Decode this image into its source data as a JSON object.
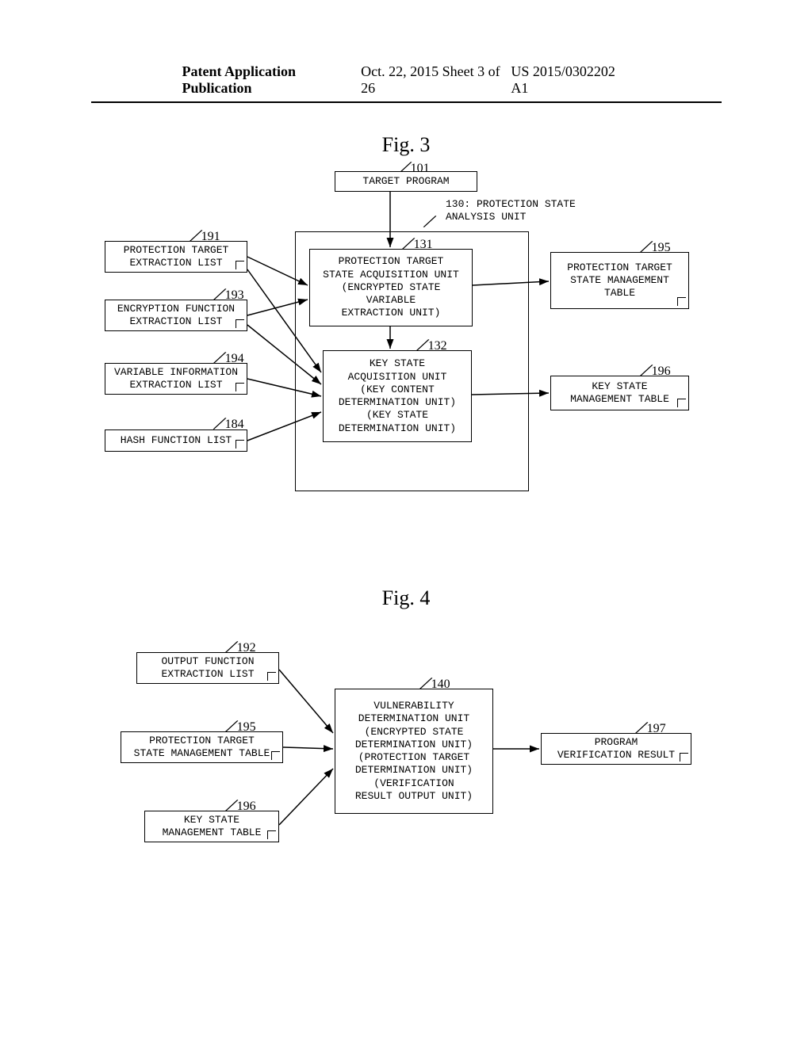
{
  "header": {
    "left": "Patent Application Publication",
    "center": "Oct. 22, 2015  Sheet 3 of 26",
    "right": "US 2015/0302202 A1"
  },
  "fig3": {
    "title": "Fig. 3",
    "unit_label": "130: PROTECTION STATE ANALYSIS UNIT",
    "refs": {
      "r101": "101",
      "r130": "130",
      "r131": "131",
      "r132": "132",
      "r191": "191",
      "r193": "193",
      "r194": "194",
      "r184": "184",
      "r195": "195",
      "r196": "196"
    },
    "boxes": {
      "target_program": "TARGET PROGRAM",
      "prot_target_ext_list": "PROTECTION TARGET\nEXTRACTION LIST",
      "enc_func_ext_list": "ENCRYPTION FUNCTION\nEXTRACTION LIST",
      "var_info_ext_list": "VARIABLE INFORMATION\nEXTRACTION LIST",
      "hash_func_list": "HASH FUNCTION LIST",
      "unit131": "PROTECTION TARGET\nSTATE ACQUISITION UNIT\n(ENCRYPTED STATE\nVARIABLE\nEXTRACTION UNIT)",
      "unit132": "KEY STATE\nACQUISITION UNIT\n(KEY CONTENT\nDETERMINATION UNIT)\n(KEY STATE\nDETERMINATION UNIT)",
      "table195": "PROTECTION TARGET\nSTATE MANAGEMENT\nTABLE",
      "table196": "KEY STATE\nMANAGEMENT TABLE"
    }
  },
  "fig4": {
    "title": "Fig. 4",
    "refs": {
      "r192": "192",
      "r195": "195",
      "r196": "196",
      "r140": "140",
      "r197": "197"
    },
    "boxes": {
      "output_func_ext_list": "OUTPUT FUNCTION\nEXTRACTION LIST",
      "prot_target_state_mgmt": "PROTECTION TARGET\nSTATE MANAGEMENT TABLE",
      "key_state_mgmt": "KEY STATE\nMANAGEMENT TABLE",
      "unit140": "VULNERABILITY\nDETERMINATION UNIT\n(ENCRYPTED STATE\nDETERMINATION UNIT)\n(PROTECTION TARGET\nDETERMINATION UNIT)\n(VERIFICATION\nRESULT OUTPUT UNIT)",
      "result197": "PROGRAM\nVERIFICATION RESULT"
    }
  }
}
